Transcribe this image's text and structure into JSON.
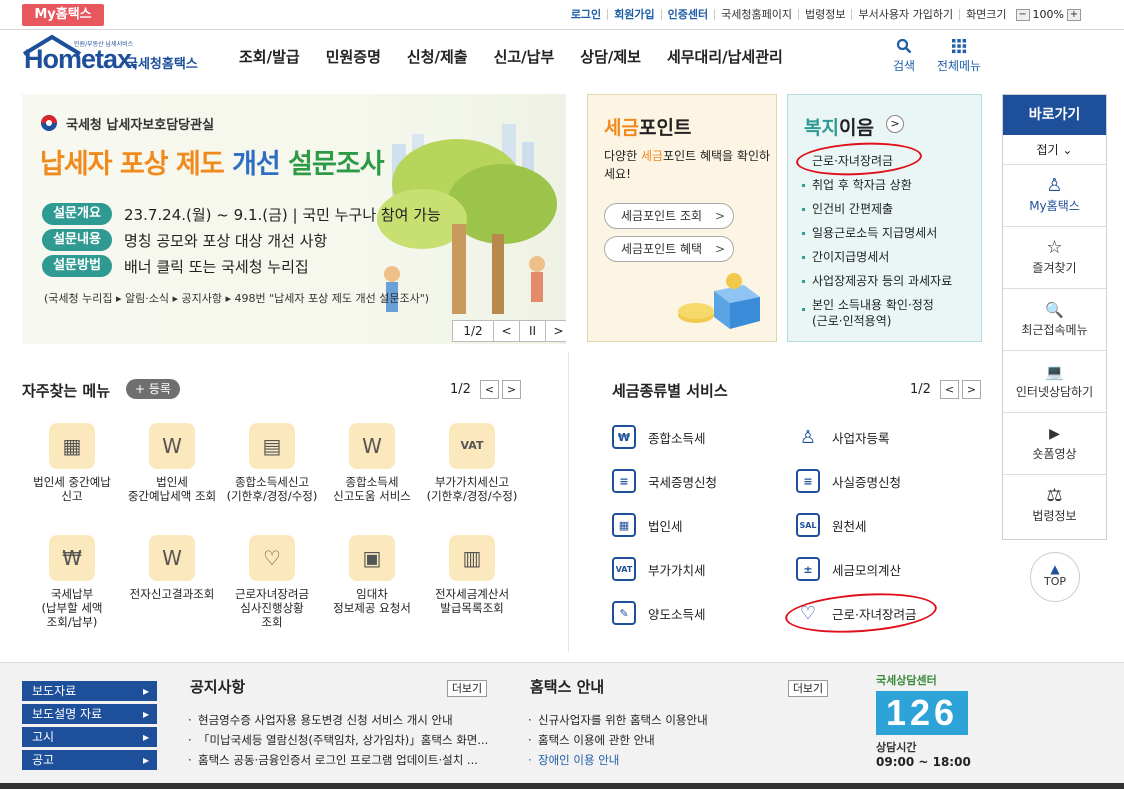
{
  "topbar": {
    "my_tab": "My홈택스",
    "links": [
      "로그인",
      "회원가입",
      "인증센터",
      "국세청홈페이지",
      "법령정보",
      "부서사용자 가입하기",
      "화면크기"
    ],
    "zoom": "100%",
    "zoom_minus": "−",
    "zoom_plus": "+"
  },
  "header": {
    "logo_word": "Hometax.",
    "logo_sub": "국세청홈택스",
    "logo_tiny": "민원/부동산 납세서비스",
    "nav": [
      "조회/발급",
      "민원증명",
      "신청/제출",
      "신고/납부",
      "상담/제보",
      "세무대리/납세관리"
    ],
    "search_label": "검색",
    "all_menu_label": "전체메뉴"
  },
  "banner": {
    "org": "국세청 납세자보호담당관실",
    "title_a": "납세자 포상 제도 ",
    "title_b": "개선",
    "title_c": " 설문조사",
    "rows": [
      {
        "tag": "설문개요",
        "text": "23.7.24.(월) ~ 9.1.(금) | 국민 누구나 참여 가능"
      },
      {
        "tag": "설문내용",
        "text": "명칭 공모와 포상 대상 개선 사항"
      },
      {
        "tag": "설문방법",
        "text": "배너 클릭 또는 국세청 누리집"
      }
    ],
    "footnote": "(국세청 누리집 ▸ 알림·소식 ▸ 공지사항 ▸ 498번 \"납세자 포상 제도 개선 설문조사\")",
    "page": "1/2",
    "prev": "<",
    "pause": "II",
    "next": ">"
  },
  "point_card": {
    "title_a": "세금",
    "title_b": "포인트",
    "desc_a": "다양한 ",
    "desc_b": "세금",
    "desc_c": "포인트 혜택을 확인하세요!",
    "btn1": "세금포인트 조회",
    "btn2": "세금포인트 혜택",
    "arrow": ">"
  },
  "welfare_card": {
    "title_a": "복지",
    "title_b": "이음",
    "arrow": ">",
    "items": [
      "근로·자녀장려금",
      "취업 후 학자금 상환",
      "인건비 간편제출",
      "일용근로소득 지급명세서",
      "간이지급명세서",
      "사업장제공자 등의 과세자료",
      "본인 소득내용 확인·정정",
      "(근로·인적용역)"
    ]
  },
  "quick": {
    "title": "바로가기",
    "fold": "접기 ⌄",
    "items": [
      {
        "label": "My홈택스",
        "icon": "person-icon",
        "glyph": "♙"
      },
      {
        "label": "즐겨찾기",
        "icon": "star-icon",
        "glyph": "☆"
      },
      {
        "label": "최근접속메뉴",
        "icon": "recent-search-icon",
        "glyph": "🔍"
      },
      {
        "label": "인터넷상담하기",
        "icon": "laptop-icon",
        "glyph": "💻"
      },
      {
        "label": "숏폼영상",
        "icon": "play-icon",
        "glyph": "▶"
      },
      {
        "label": "법령정보",
        "icon": "gavel-icon",
        "glyph": "⚖"
      }
    ],
    "top": "TOP"
  },
  "frequent": {
    "title": "자주찾는 메뉴",
    "add": "+ 등록",
    "page": "1/2",
    "items": [
      {
        "label": "법인세 중간예납\n신고",
        "glyph": "▦"
      },
      {
        "label": "법인세\n중간예납세액 조회",
        "glyph": "W"
      },
      {
        "label": "종합소득세신고\n(기한후/경정/수정)",
        "glyph": "▤"
      },
      {
        "label": "종합소득세\n신고도움 서비스",
        "glyph": "W"
      },
      {
        "label": "부가가치세신고\n(기한후/경정/수정)",
        "glyph": "VAT"
      },
      {
        "label": "국세납부\n(납부할 세액\n조회/납부)",
        "glyph": "₩"
      },
      {
        "label": "전자신고결과조회",
        "glyph": "W"
      },
      {
        "label": "근로자녀장려금\n심사진행상황\n조회",
        "glyph": "♡"
      },
      {
        "label": "임대차\n정보제공 요청서",
        "glyph": "▣"
      },
      {
        "label": "전자세금계산서\n발급목록조회",
        "glyph": "▥"
      }
    ]
  },
  "tax_services": {
    "title": "세금종류별 서비스",
    "page": "1/2",
    "items": [
      {
        "label": "종합소득세",
        "glyph": "₩"
      },
      {
        "label": "사업자등록",
        "glyph": "♙"
      },
      {
        "label": "국세증명신청",
        "glyph": "≡"
      },
      {
        "label": "사실증명신청",
        "glyph": "≡"
      },
      {
        "label": "법인세",
        "glyph": "▦"
      },
      {
        "label": "원천세",
        "glyph": "SAL"
      },
      {
        "label": "부가가치세",
        "glyph": "VAT"
      },
      {
        "label": "세금모의계산",
        "glyph": "±"
      },
      {
        "label": "양도소득세",
        "glyph": "✎"
      },
      {
        "label": "근로·자녀장려금",
        "glyph": "♡"
      }
    ]
  },
  "bottom": {
    "side_links": [
      "보도자료",
      "보도설명 자료",
      "고시",
      "공고"
    ],
    "notice_title": "공지사항",
    "notice_more": "더보기",
    "notices": [
      "현금영수증 사업자용 용도변경 신청 서비스 개시 안내",
      "「미납국세등 열람신청(주택임차, 상가임차)」홈택스 화면...",
      "홈택스 공동·금융인증서 로그인 프로그램 업데이트·설치 ..."
    ],
    "guide_title": "홈택스 안내",
    "guide_more": "더보기",
    "guides": [
      "신규사업자를 위한 홈택스 이용안내",
      "홈택스 이용에 관한 안내",
      "장애인 이용 안내"
    ],
    "center_label": "국세상담센터",
    "center_number": "126",
    "hours_label": "상담시간",
    "hours": "09:00 ~ 18:00"
  },
  "colors": {
    "brand_blue": "#1e4f9a",
    "orange": "#f08a1c",
    "teal": "#2e9a91",
    "red_mark": "#e0101a"
  }
}
